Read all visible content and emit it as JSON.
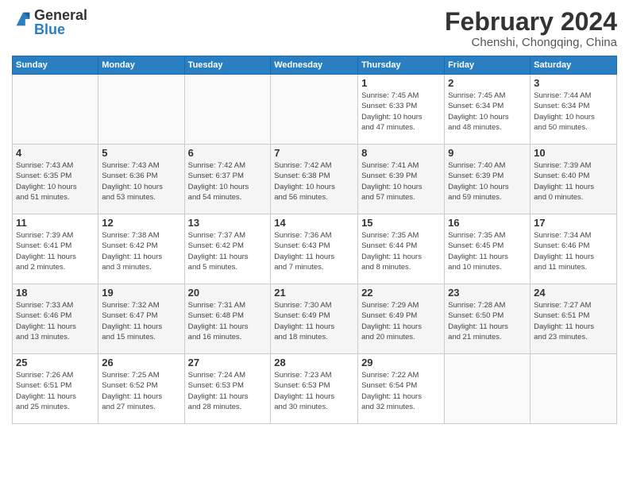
{
  "logo": {
    "general": "General",
    "blue": "Blue"
  },
  "title": "February 2024",
  "location": "Chenshi, Chongqing, China",
  "days_of_week": [
    "Sunday",
    "Monday",
    "Tuesday",
    "Wednesday",
    "Thursday",
    "Friday",
    "Saturday"
  ],
  "weeks": [
    [
      {
        "day": "",
        "info": ""
      },
      {
        "day": "",
        "info": ""
      },
      {
        "day": "",
        "info": ""
      },
      {
        "day": "",
        "info": ""
      },
      {
        "day": "1",
        "info": "Sunrise: 7:45 AM\nSunset: 6:33 PM\nDaylight: 10 hours\nand 47 minutes."
      },
      {
        "day": "2",
        "info": "Sunrise: 7:45 AM\nSunset: 6:34 PM\nDaylight: 10 hours\nand 48 minutes."
      },
      {
        "day": "3",
        "info": "Sunrise: 7:44 AM\nSunset: 6:34 PM\nDaylight: 10 hours\nand 50 minutes."
      }
    ],
    [
      {
        "day": "4",
        "info": "Sunrise: 7:43 AM\nSunset: 6:35 PM\nDaylight: 10 hours\nand 51 minutes."
      },
      {
        "day": "5",
        "info": "Sunrise: 7:43 AM\nSunset: 6:36 PM\nDaylight: 10 hours\nand 53 minutes."
      },
      {
        "day": "6",
        "info": "Sunrise: 7:42 AM\nSunset: 6:37 PM\nDaylight: 10 hours\nand 54 minutes."
      },
      {
        "day": "7",
        "info": "Sunrise: 7:42 AM\nSunset: 6:38 PM\nDaylight: 10 hours\nand 56 minutes."
      },
      {
        "day": "8",
        "info": "Sunrise: 7:41 AM\nSunset: 6:39 PM\nDaylight: 10 hours\nand 57 minutes."
      },
      {
        "day": "9",
        "info": "Sunrise: 7:40 AM\nSunset: 6:39 PM\nDaylight: 10 hours\nand 59 minutes."
      },
      {
        "day": "10",
        "info": "Sunrise: 7:39 AM\nSunset: 6:40 PM\nDaylight: 11 hours\nand 0 minutes."
      }
    ],
    [
      {
        "day": "11",
        "info": "Sunrise: 7:39 AM\nSunset: 6:41 PM\nDaylight: 11 hours\nand 2 minutes."
      },
      {
        "day": "12",
        "info": "Sunrise: 7:38 AM\nSunset: 6:42 PM\nDaylight: 11 hours\nand 3 minutes."
      },
      {
        "day": "13",
        "info": "Sunrise: 7:37 AM\nSunset: 6:42 PM\nDaylight: 11 hours\nand 5 minutes."
      },
      {
        "day": "14",
        "info": "Sunrise: 7:36 AM\nSunset: 6:43 PM\nDaylight: 11 hours\nand 7 minutes."
      },
      {
        "day": "15",
        "info": "Sunrise: 7:35 AM\nSunset: 6:44 PM\nDaylight: 11 hours\nand 8 minutes."
      },
      {
        "day": "16",
        "info": "Sunrise: 7:35 AM\nSunset: 6:45 PM\nDaylight: 11 hours\nand 10 minutes."
      },
      {
        "day": "17",
        "info": "Sunrise: 7:34 AM\nSunset: 6:46 PM\nDaylight: 11 hours\nand 11 minutes."
      }
    ],
    [
      {
        "day": "18",
        "info": "Sunrise: 7:33 AM\nSunset: 6:46 PM\nDaylight: 11 hours\nand 13 minutes."
      },
      {
        "day": "19",
        "info": "Sunrise: 7:32 AM\nSunset: 6:47 PM\nDaylight: 11 hours\nand 15 minutes."
      },
      {
        "day": "20",
        "info": "Sunrise: 7:31 AM\nSunset: 6:48 PM\nDaylight: 11 hours\nand 16 minutes."
      },
      {
        "day": "21",
        "info": "Sunrise: 7:30 AM\nSunset: 6:49 PM\nDaylight: 11 hours\nand 18 minutes."
      },
      {
        "day": "22",
        "info": "Sunrise: 7:29 AM\nSunset: 6:49 PM\nDaylight: 11 hours\nand 20 minutes."
      },
      {
        "day": "23",
        "info": "Sunrise: 7:28 AM\nSunset: 6:50 PM\nDaylight: 11 hours\nand 21 minutes."
      },
      {
        "day": "24",
        "info": "Sunrise: 7:27 AM\nSunset: 6:51 PM\nDaylight: 11 hours\nand 23 minutes."
      }
    ],
    [
      {
        "day": "25",
        "info": "Sunrise: 7:26 AM\nSunset: 6:51 PM\nDaylight: 11 hours\nand 25 minutes."
      },
      {
        "day": "26",
        "info": "Sunrise: 7:25 AM\nSunset: 6:52 PM\nDaylight: 11 hours\nand 27 minutes."
      },
      {
        "day": "27",
        "info": "Sunrise: 7:24 AM\nSunset: 6:53 PM\nDaylight: 11 hours\nand 28 minutes."
      },
      {
        "day": "28",
        "info": "Sunrise: 7:23 AM\nSunset: 6:53 PM\nDaylight: 11 hours\nand 30 minutes."
      },
      {
        "day": "29",
        "info": "Sunrise: 7:22 AM\nSunset: 6:54 PM\nDaylight: 11 hours\nand 32 minutes."
      },
      {
        "day": "",
        "info": ""
      },
      {
        "day": "",
        "info": ""
      }
    ]
  ]
}
